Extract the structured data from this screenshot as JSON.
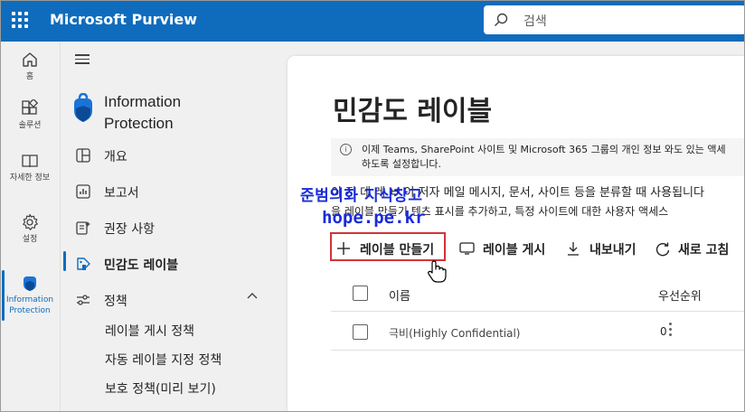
{
  "header": {
    "app_name": "Microsoft Purview",
    "search_placeholder": "검색"
  },
  "rail": {
    "items": [
      {
        "label": "홈",
        "icon": "home-icon"
      },
      {
        "label": "솔루션",
        "icon": "solutions-icon"
      },
      {
        "label": "자세한 정보",
        "icon": "learn-icon"
      },
      {
        "label": "설정",
        "icon": "gear-icon"
      },
      {
        "label": "Information Protection",
        "icon": "information-protection-icon"
      }
    ]
  },
  "nav": {
    "app_title_line1": "Information",
    "app_title_line2": "Protection",
    "items": [
      {
        "label": "개요",
        "icon": "overview-icon"
      },
      {
        "label": "보고서",
        "icon": "reports-icon"
      },
      {
        "label": "권장 사항",
        "icon": "recommendations-icon"
      },
      {
        "label": "민감도 레이블",
        "icon": "sensitivity-label-icon",
        "active": true
      },
      {
        "label": "정책",
        "icon": "policy-icon",
        "expanded": true
      }
    ],
    "sub_items": [
      {
        "label": "레이블 게시 정책"
      },
      {
        "label": "자동 레이블 지정 정책"
      },
      {
        "label": "보호 정책(미리 보기)"
      }
    ]
  },
  "main": {
    "title": "민감도 레이블",
    "info_line1": "이제 Teams, SharePoint 사이트 및 Microsoft 365 그룹의 개인 정보 와도 있는 액세",
    "info_line2": "하도록 설정합니다.",
    "desc_line1": "이 지 데 레 ㅂ 이 저자 메일 메시지, 문서, 사이트 등을 분류할 때 사용됩니다",
    "desc_line2": "을   레이블 만들기   텐츠 표시를 추가하고, 특정 사이트에 대한 사용자 액세스",
    "watermark_line1": "준범의화 지식창고",
    "watermark_line2": "hope.pe.kr",
    "commands": [
      {
        "label": "레이블 만들기",
        "icon": "plus-icon"
      },
      {
        "label": "레이블 게시",
        "icon": "publish-icon"
      },
      {
        "label": "내보내기",
        "icon": "download-icon"
      },
      {
        "label": "새로 고침",
        "icon": "refresh-icon"
      }
    ],
    "table": {
      "columns": [
        "이름",
        "우선순위"
      ],
      "rows": [
        {
          "name": "극비(Highly Confidential)",
          "priority": "0"
        }
      ]
    }
  },
  "colors": {
    "brand": "#0f6cbd",
    "highlight": "#d13438",
    "watermark": "#1a2bd8"
  }
}
